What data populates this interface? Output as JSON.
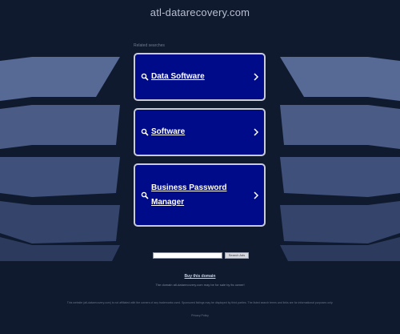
{
  "header": {
    "domain": "atl-datarecovery.com"
  },
  "related": {
    "label": "Related searches",
    "links": [
      {
        "label": "Data Software"
      },
      {
        "label": "Software"
      },
      {
        "label": "Business Password Manager"
      }
    ]
  },
  "search": {
    "placeholder": "",
    "button_label": "Search Ads"
  },
  "footer": {
    "buy_link": "Buy this domain",
    "owner_note": "The domain atl-datarecovery.com may be for sale by its owner!",
    "disclaimer": "This website (atl-datarecovery.com) is not affiliated with the owners of any trademarks used. Sponsored listings may be displayed by third parties. The listed search terms and links are for informational purposes only.",
    "privacy": "Privacy Policy"
  },
  "colors": {
    "background": "#101a2f",
    "link_box": "#000b8a",
    "link_border": "#c9ccd6",
    "deco_light": "#5d6f99",
    "deco_dark": "#2a3756"
  }
}
